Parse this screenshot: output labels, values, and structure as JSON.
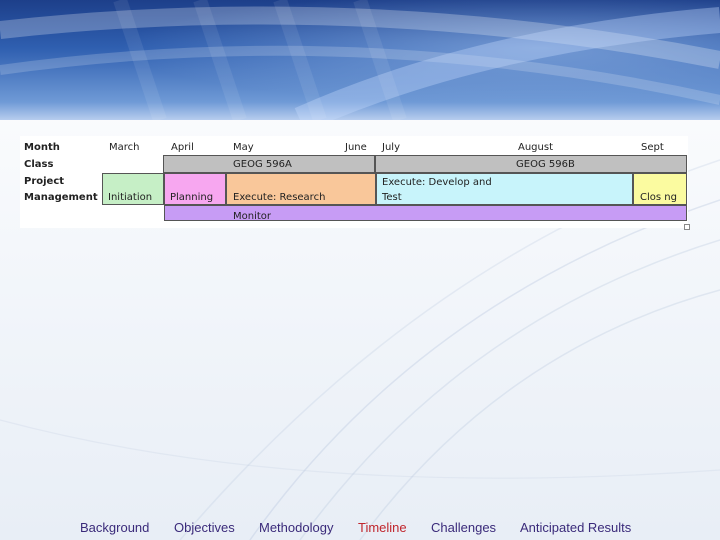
{
  "gantt": {
    "months": [
      "Month",
      "March",
      "April",
      "May",
      "June",
      "July",
      "August",
      "Sept"
    ],
    "row_labels": {
      "class": "Class",
      "project": "Project",
      "management": "Management"
    },
    "class_bars": [
      "GEOG 596A",
      "GEOG 596B"
    ],
    "phases": {
      "initiation": "Initiation",
      "planning": "Planning",
      "execute_research": "Execute: Research",
      "execute_develop_line1": "Execute: Develop and",
      "execute_develop_line2": "Test",
      "closing": "Clos ng",
      "monitor": "Monitor"
    },
    "colors": {
      "class_bar": "#c0c0c0",
      "initiation": "#c6efc6",
      "planning": "#f7a7f0",
      "execute_research": "#f9c79a",
      "execute_develop": "#c8f4fb",
      "closing": "#fbfba0",
      "monitor": "#c79cf5"
    }
  },
  "nav": {
    "items": [
      "Background",
      "Objectives",
      "Methodology",
      "Timeline",
      "Challenges",
      "Anticipated Results"
    ],
    "active": "Timeline",
    "active_color": "#c0262d",
    "color": "#3a2a7a"
  }
}
